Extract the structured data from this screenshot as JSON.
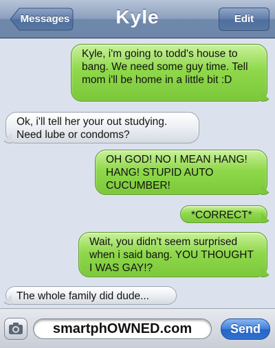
{
  "nav": {
    "back_label": "Messages",
    "title": "Kyle",
    "edit_label": "Edit"
  },
  "messages": [
    {
      "side": "out",
      "text": "Kyle, i'm going to todd's house to bang. We need some guy time. Tell mom i'll be home in a little bit :D"
    },
    {
      "side": "in",
      "text": "Ok, i'll tell her your out studying. Need lube or condoms?"
    },
    {
      "side": "out",
      "text": "OH GOD! NO I MEAN HANG! HANG! STUPID AUTO CUCUMBER!"
    },
    {
      "side": "out",
      "text": "*CORRECT*"
    },
    {
      "side": "out",
      "text": "Wait, you didn't seem surprised when i said bang. YOU THOUGHT I WAS GAY!?"
    },
    {
      "side": "in",
      "text": "The whole family did dude..."
    }
  ],
  "composer": {
    "field_text": "smartphOWNED.com",
    "send_label": "Send",
    "camera_icon": "camera-icon"
  },
  "colors": {
    "outgoing": "#8fd84b",
    "incoming": "#e6e9ee",
    "send": "#3f7fd8"
  }
}
